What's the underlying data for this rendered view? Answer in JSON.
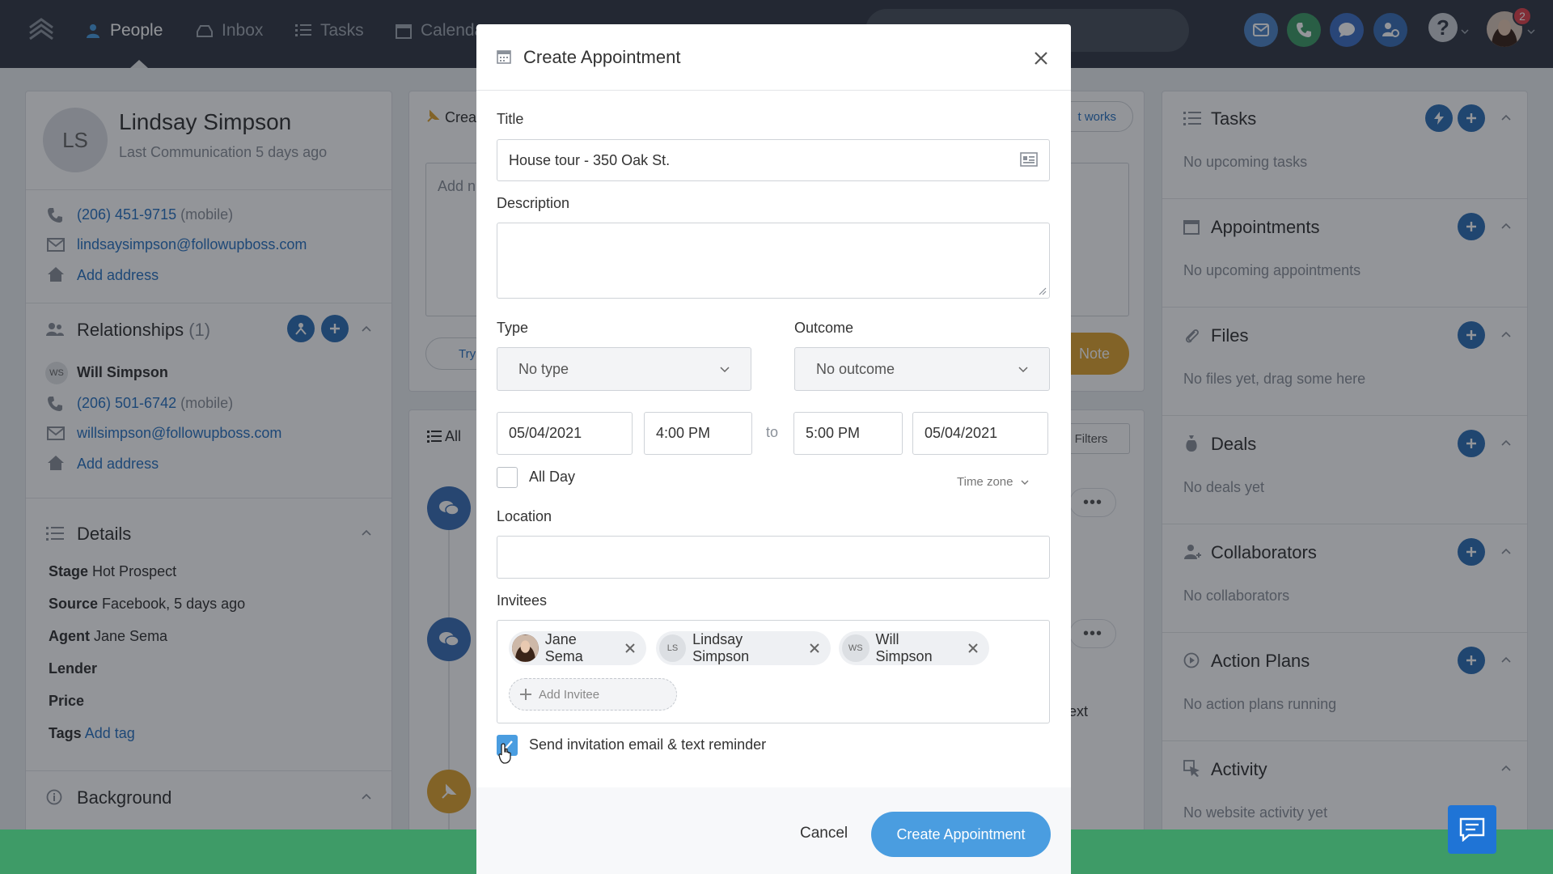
{
  "nav": {
    "items": [
      {
        "label": "People"
      },
      {
        "label": "Inbox"
      },
      {
        "label": "Tasks"
      },
      {
        "label": "Calendar"
      }
    ],
    "notification_count": "2"
  },
  "contact": {
    "initials": "LS",
    "name": "Lindsay Simpson",
    "last_comm_label": "Last Communication",
    "last_comm_value": "5 days ago",
    "phone": "(206) 451-9715",
    "phone_type": "(mobile)",
    "email": "lindsaysimpson@followupboss.com",
    "add_address": "Add address"
  },
  "relationships": {
    "title": "Relationships",
    "count": "(1)",
    "person": {
      "initials": "WS",
      "name": "Will Simpson",
      "phone": "(206) 501-6742",
      "phone_type": "(mobile)",
      "email": "willsimpson@followupboss.com",
      "add_address": "Add address"
    }
  },
  "details": {
    "title": "Details",
    "rows": [
      {
        "label": "Stage",
        "value": "Hot Prospect"
      },
      {
        "label": "Source",
        "value": "Facebook, 5 days ago"
      },
      {
        "label": "Agent",
        "value": "Jane Sema"
      },
      {
        "label": "Lender",
        "value": ""
      },
      {
        "label": "Price",
        "value": ""
      },
      {
        "label": "Tags",
        "value": "Add tag"
      }
    ]
  },
  "background": {
    "title": "Background"
  },
  "middle": {
    "create_tab": "Crea",
    "how_it_works": "t works",
    "note_placeholder": "Add n",
    "try_chip": "Try",
    "note_btn": "Note",
    "filter_all": "All",
    "filters": "Filters",
    "ext_text": "ext"
  },
  "right": {
    "sections": [
      {
        "title": "Tasks",
        "empty": "No upcoming tasks"
      },
      {
        "title": "Appointments",
        "empty": "No upcoming appointments"
      },
      {
        "title": "Files",
        "empty": "No files yet, drag some here"
      },
      {
        "title": "Deals",
        "empty": "No deals yet"
      },
      {
        "title": "Collaborators",
        "empty": "No collaborators"
      },
      {
        "title": "Action Plans",
        "empty": "No action plans running"
      },
      {
        "title": "Activity",
        "empty": "No website activity yet"
      }
    ]
  },
  "modal": {
    "title": "Create Appointment",
    "title_label": "Title",
    "title_value": "House tour - 350 Oak St.",
    "description_label": "Description",
    "description_value": "",
    "type_label": "Type",
    "type_value": "No type",
    "outcome_label": "Outcome",
    "outcome_value": "No outcome",
    "start_date": "05/04/2021",
    "start_time": "4:00 PM",
    "to_label": "to",
    "end_time": "5:00 PM",
    "end_date": "05/04/2021",
    "all_day_label": "All Day",
    "time_zone_label": "Time zone",
    "location_label": "Location",
    "location_value": "",
    "invitees_label": "Invitees",
    "invitees": [
      {
        "initials": "",
        "name": "Jane Sema"
      },
      {
        "initials": "LS",
        "name": "Lindsay Simpson"
      },
      {
        "initials": "WS",
        "name": "Will Simpson"
      }
    ],
    "add_invitee": "Add Invitee",
    "send_invite_label": "Send invitation email & text reminder",
    "send_invite_checked": true,
    "cancel": "Cancel",
    "submit": "Create Appointment"
  },
  "colors": {
    "nav_bg": "#333a45",
    "primary": "#2f6fb5",
    "button_blue": "#4a9de0",
    "link": "#2a74c2",
    "green_bar": "#3e9b67",
    "badge_red": "#e0434c"
  }
}
